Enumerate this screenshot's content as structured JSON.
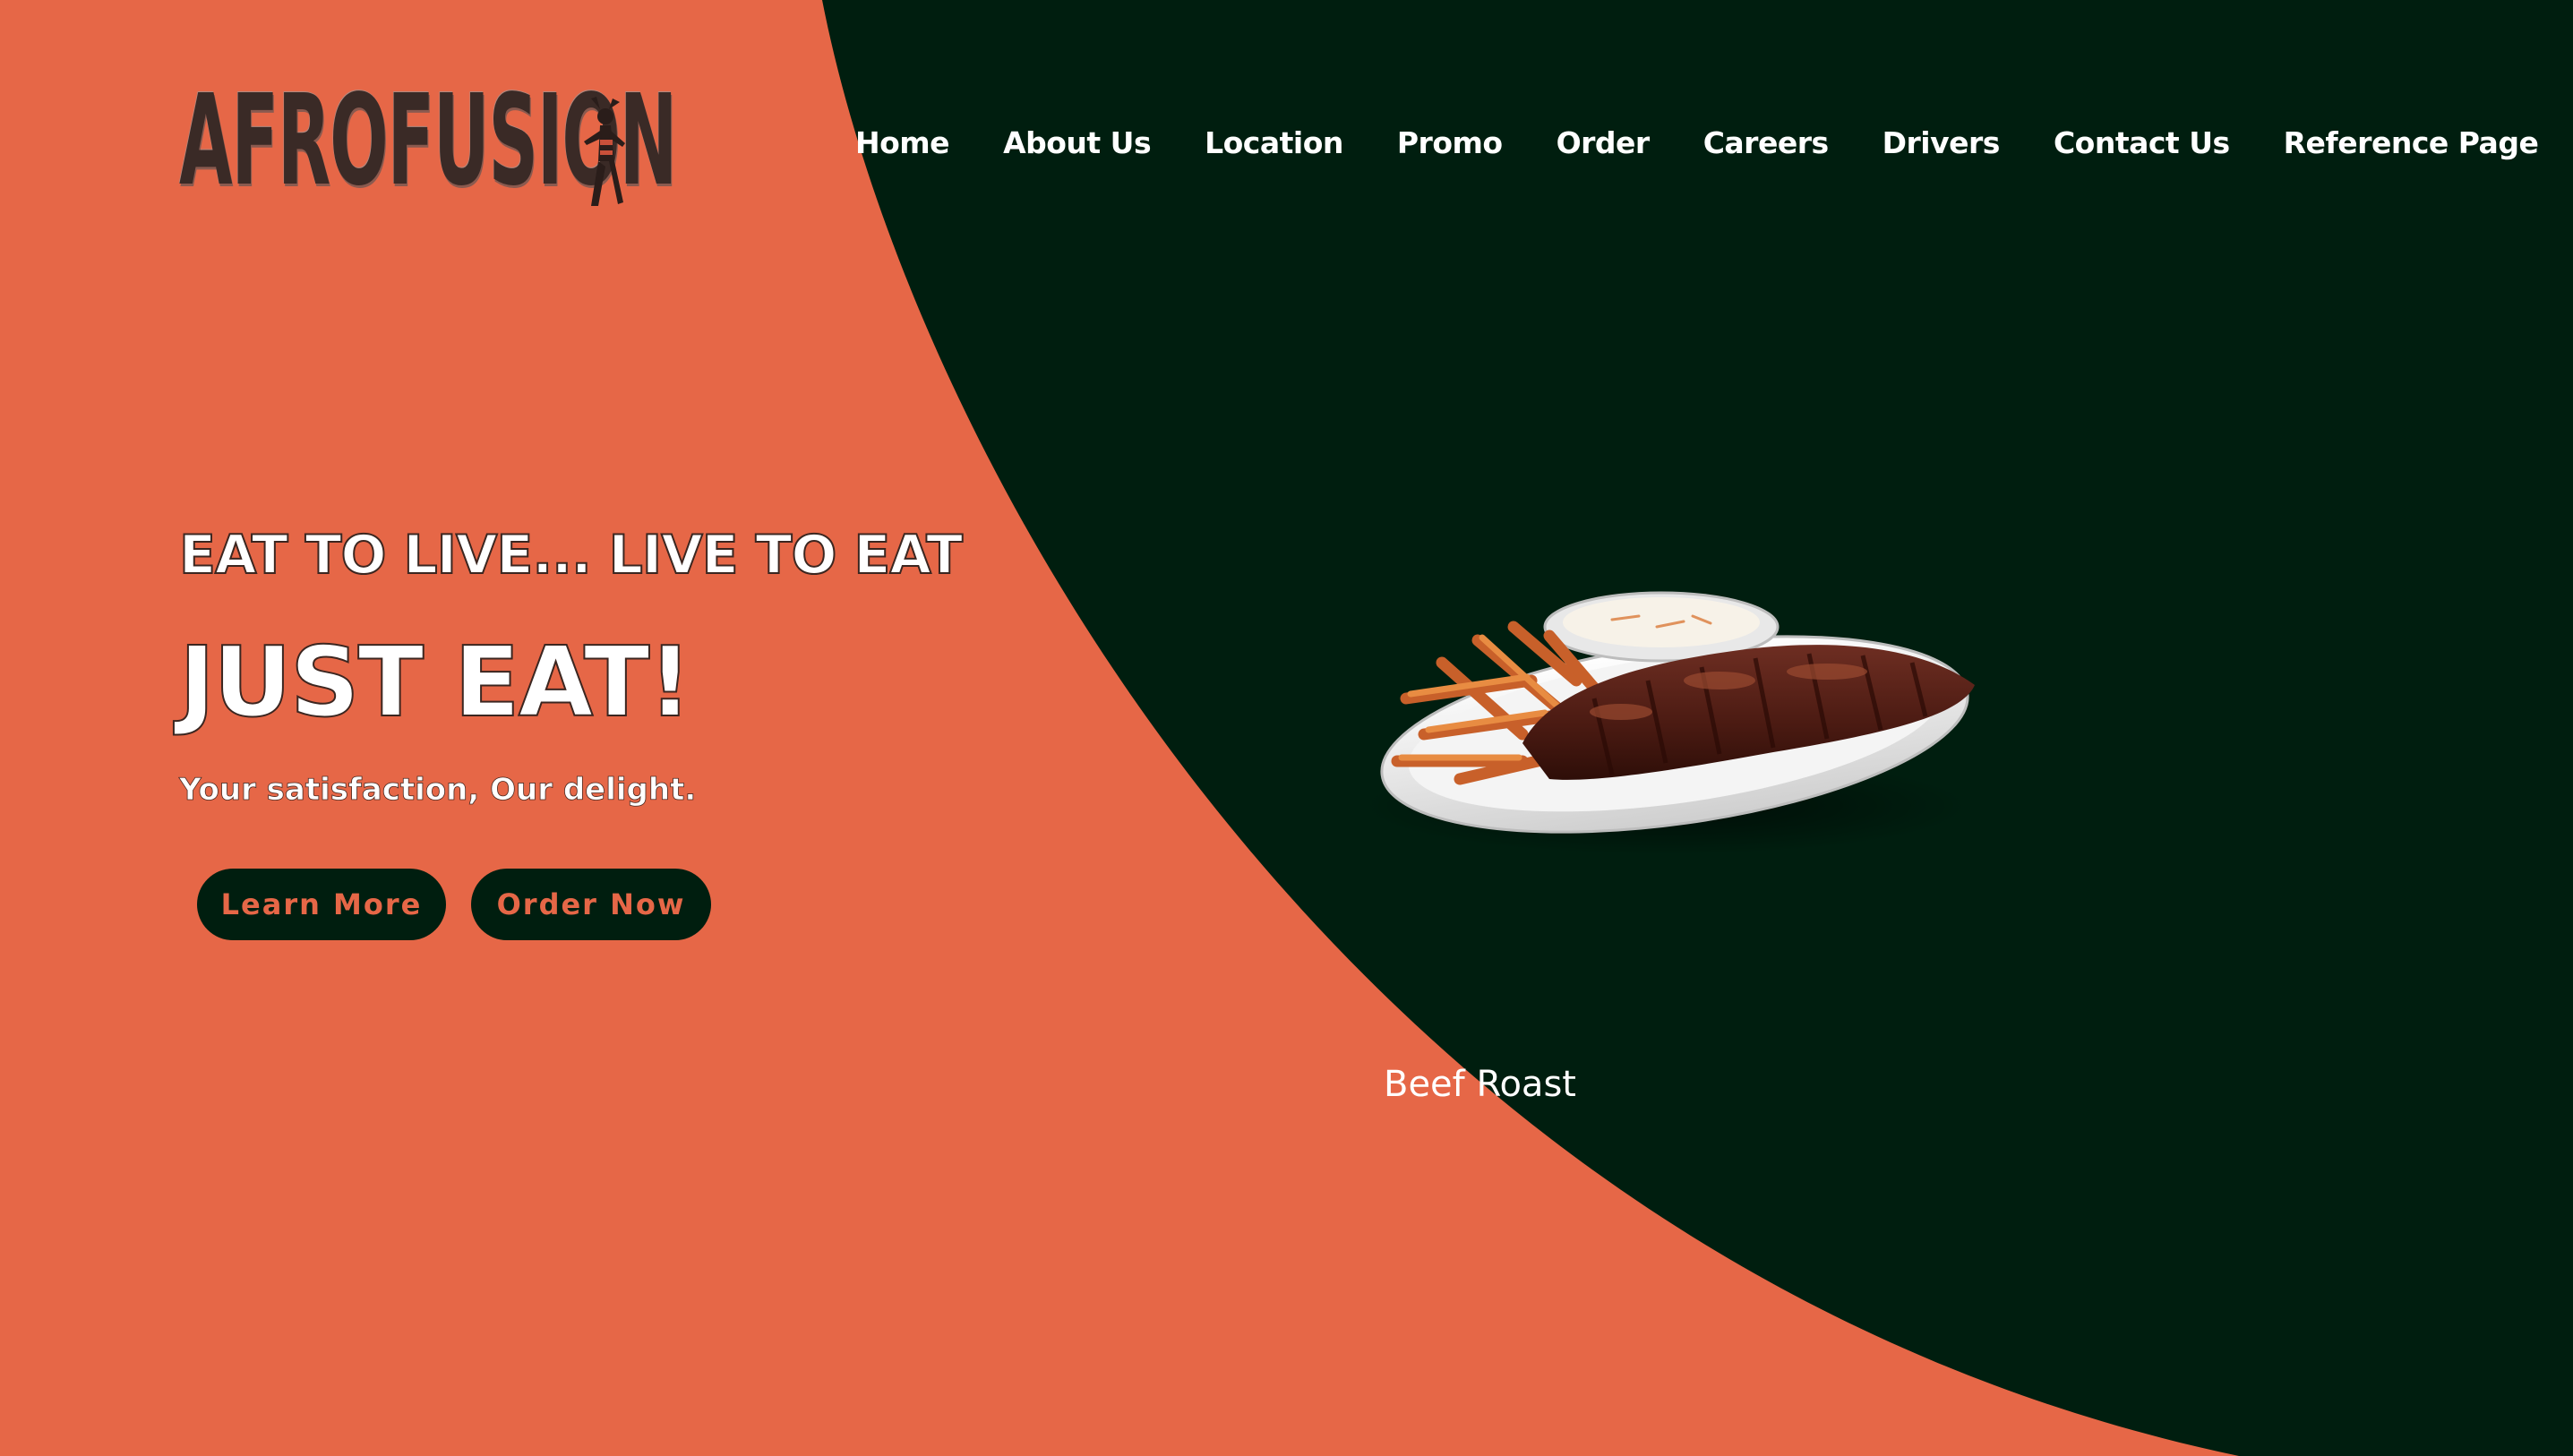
{
  "brand": {
    "logo_text": "AFROFUSION",
    "colors": {
      "accent": "#E66747",
      "dark": "#001E0F",
      "text": "#FFFFFF"
    }
  },
  "nav": {
    "items": [
      {
        "label": "Home"
      },
      {
        "label": "About Us"
      },
      {
        "label": "Location"
      },
      {
        "label": "Promo"
      },
      {
        "label": "Order"
      },
      {
        "label": "Careers"
      },
      {
        "label": "Drivers"
      },
      {
        "label": "Contact Us"
      },
      {
        "label": "Reference Page"
      }
    ]
  },
  "hero": {
    "tagline": "EAT TO LIVE... LIVE TO EAT",
    "headline": "JUST EAT!",
    "subline": "Your satisfaction, Our delight.",
    "buttons": {
      "learn_more": "Learn More",
      "order_now": "Order Now"
    }
  },
  "featured": {
    "image": "ribs-fries-coleslaw-plate",
    "caption": "Beef Roast"
  }
}
